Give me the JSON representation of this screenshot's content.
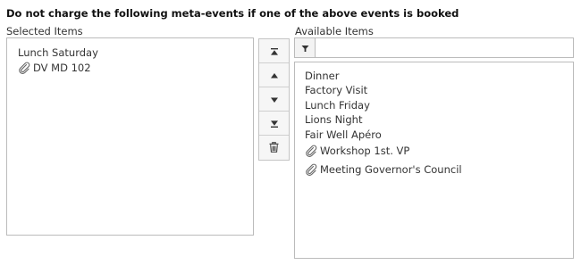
{
  "heading": "Do not charge the following meta-events if one of the above events is booked",
  "selected": {
    "label": "Selected Items",
    "items": [
      {
        "label": "Lunch Saturday",
        "icon": ""
      },
      {
        "label": "DV MD 102",
        "icon": "paperclip-icon"
      }
    ]
  },
  "controls": {
    "buttons": [
      {
        "name": "move-to-top-button",
        "icon": "move-to-top-icon"
      },
      {
        "name": "move-up-button",
        "icon": "arrow-up-icon"
      },
      {
        "name": "move-down-button",
        "icon": "arrow-down-icon"
      },
      {
        "name": "move-to-bottom-button",
        "icon": "move-to-bottom-icon"
      },
      {
        "name": "remove-button",
        "icon": "trash-icon"
      }
    ]
  },
  "available": {
    "label": "Available Items",
    "filter": {
      "icon": "filter-icon",
      "placeholder": "",
      "value": ""
    },
    "items": [
      {
        "label": "Dinner",
        "icon": ""
      },
      {
        "label": "Factory Visit",
        "icon": ""
      },
      {
        "label": "Lunch Friday",
        "icon": ""
      },
      {
        "label": "Lions Night",
        "icon": ""
      },
      {
        "label": "Fair Well Apéro",
        "icon": ""
      },
      {
        "label": "Workshop 1st. VP",
        "icon": "paperclip-icon"
      },
      {
        "label": "Meeting Governor's Council",
        "icon": "paperclip-icon"
      }
    ]
  }
}
